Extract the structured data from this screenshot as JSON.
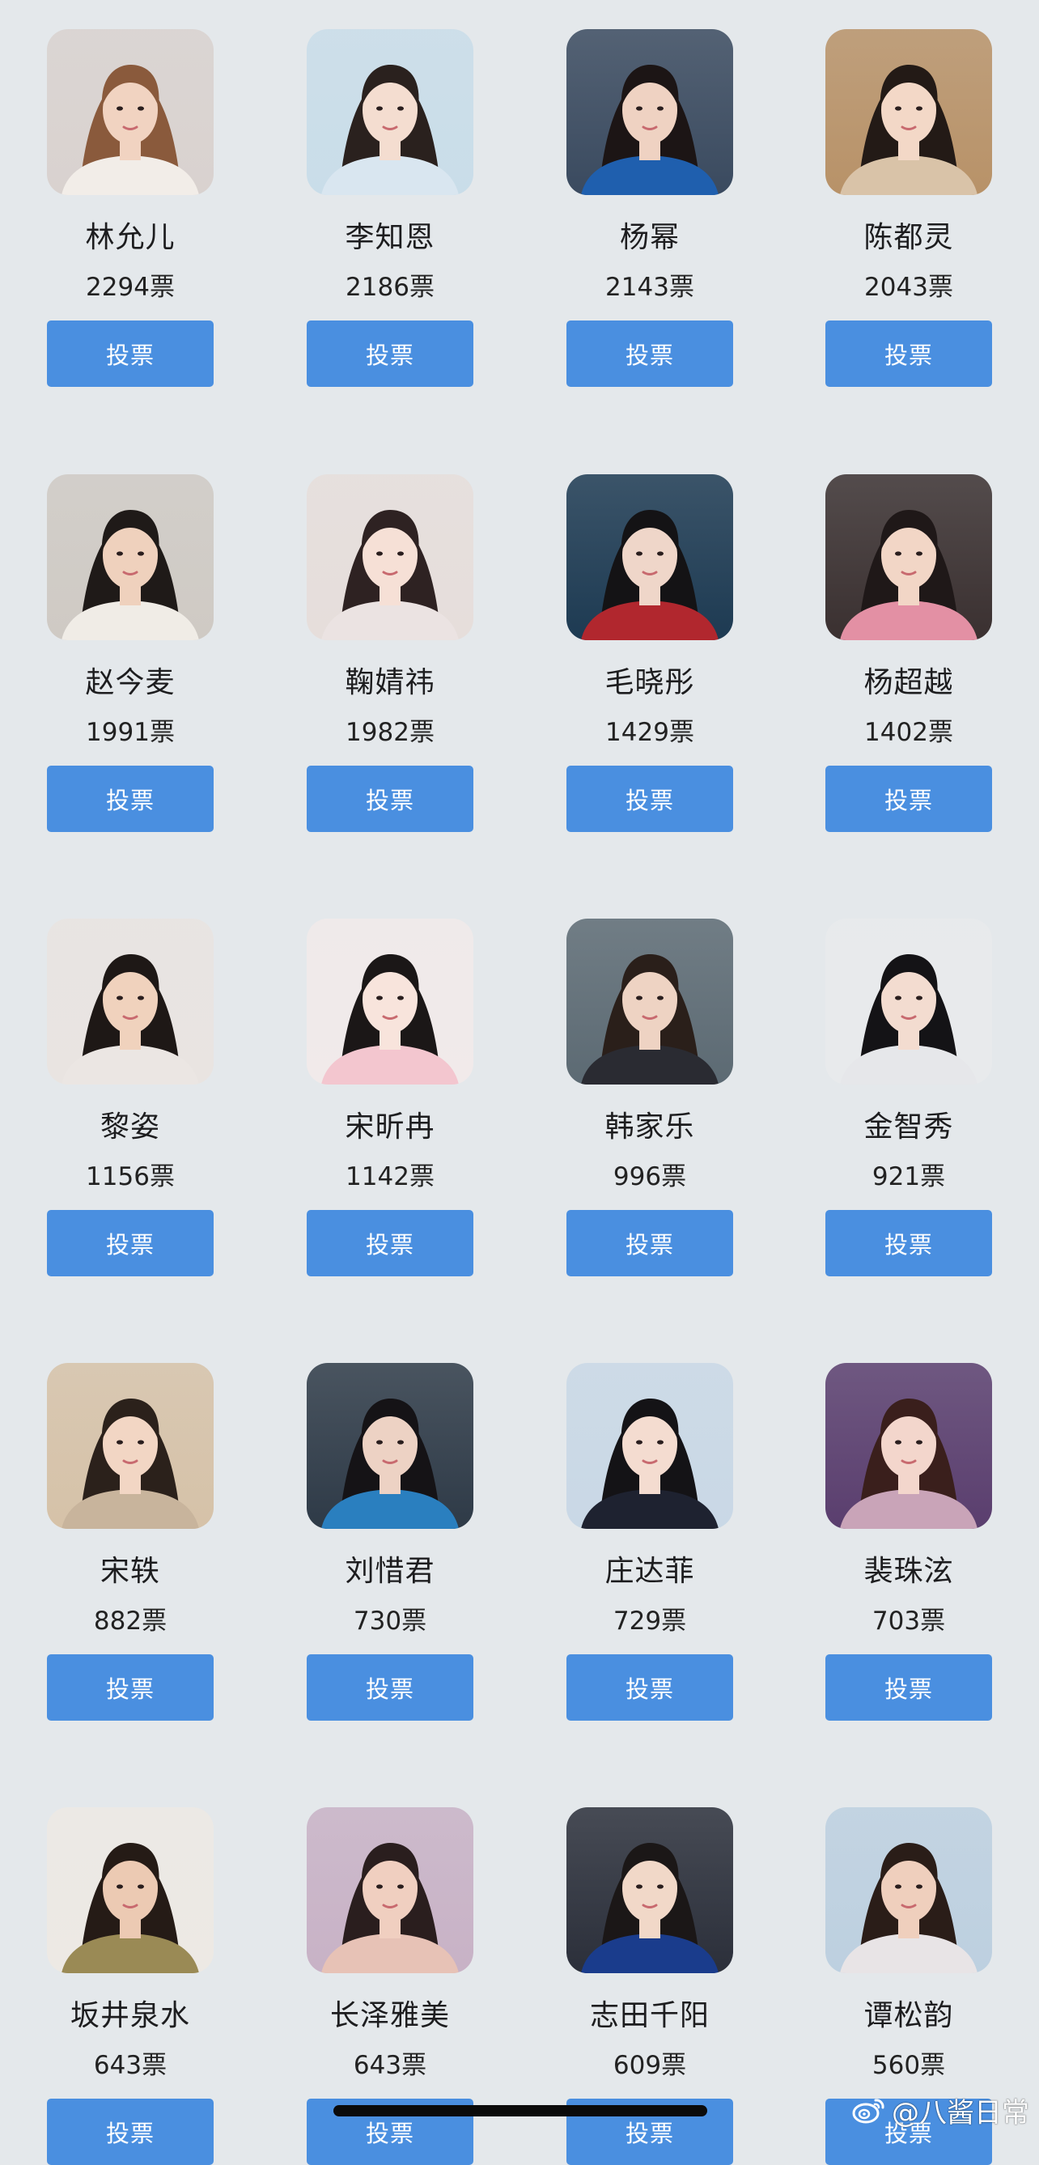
{
  "candidates": [
    {
      "name": "林允儿",
      "votes": "2294票",
      "vote_label": "投票",
      "photo": {
        "bg": "#d9d2cf",
        "hair": "#8a5a3c",
        "skin": "#f1d3c1",
        "cloth": "#f2ede8"
      }
    },
    {
      "name": "李知恩",
      "votes": "2186票",
      "vote_label": "投票",
      "photo": {
        "bg": "#c9dde9",
        "hair": "#2a211e",
        "skin": "#f4ddd0",
        "cloth": "#d9e6f0"
      }
    },
    {
      "name": "杨幂",
      "votes": "2143票",
      "vote_label": "投票",
      "photo": {
        "bg": "#3a4a5f",
        "hair": "#1c1515",
        "skin": "#efd2c2",
        "cloth": "#1f5fae"
      }
    },
    {
      "name": "陈都灵",
      "votes": "2043票",
      "vote_label": "投票",
      "photo": {
        "bg": "#b89268",
        "hair": "#231a16",
        "skin": "#f3d8c7",
        "cloth": "#d9c3a8"
      }
    },
    {
      "name": "赵今麦",
      "votes": "1991票",
      "vote_label": "投票",
      "photo": {
        "bg": "#cfcac4",
        "hair": "#1f1a18",
        "skin": "#efd1bd",
        "cloth": "#f0ece6"
      }
    },
    {
      "name": "鞠婧祎",
      "votes": "1982票",
      "vote_label": "投票",
      "photo": {
        "bg": "#e6dedb",
        "hair": "#2e2222",
        "skin": "#f6e0d6",
        "cloth": "#ebe3e2"
      }
    },
    {
      "name": "毛晓彤",
      "votes": "1429票",
      "vote_label": "投票",
      "photo": {
        "bg": "#1d3a52",
        "hair": "#141315",
        "skin": "#efd6c9",
        "cloth": "#b1272e"
      }
    },
    {
      "name": "杨超越",
      "votes": "1402票",
      "vote_label": "投票",
      "photo": {
        "bg": "#3a3030",
        "hair": "#1f1818",
        "skin": "#f2d6c6",
        "cloth": "#e390a4"
      }
    },
    {
      "name": "黎姿",
      "votes": "1156票",
      "vote_label": "投票",
      "photo": {
        "bg": "#e9e4e1",
        "hair": "#1e1816",
        "skin": "#f0d2bd",
        "cloth": "#ebe6e3"
      }
    },
    {
      "name": "宋昕冉",
      "votes": "1142票",
      "vote_label": "投票",
      "photo": {
        "bg": "#f1eaea",
        "hair": "#1b1717",
        "skin": "#f8e4dc",
        "cloth": "#f3c6cf"
      }
    },
    {
      "name": "韩家乐",
      "votes": "996票",
      "vote_label": "投票",
      "photo": {
        "bg": "#5c6a73",
        "hair": "#2a1f1a",
        "skin": "#eed3c3",
        "cloth": "#2a2b32"
      }
    },
    {
      "name": "金智秀",
      "votes": "921票",
      "vote_label": "投票",
      "photo": {
        "bg": "#e8eaec",
        "hair": "#141316",
        "skin": "#f3dcd0",
        "cloth": "#e6e7ea"
      }
    },
    {
      "name": "宋轶",
      "votes": "882票",
      "vote_label": "投票",
      "photo": {
        "bg": "#d6c2a8",
        "hair": "#2b211b",
        "skin": "#f2d6c4",
        "cloth": "#c8b49c"
      }
    },
    {
      "name": "刘惜君",
      "votes": "730票",
      "vote_label": "投票",
      "photo": {
        "bg": "#2e3a47",
        "hair": "#151316",
        "skin": "#edd2c4",
        "cloth": "#2a7fbf"
      }
    },
    {
      "name": "庄达菲",
      "votes": "729票",
      "vote_label": "投票",
      "photo": {
        "bg": "#c9d8e6",
        "hair": "#141316",
        "skin": "#f4dcd0",
        "cloth": "#1e2230"
      }
    },
    {
      "name": "裴珠泫",
      "votes": "703票",
      "vote_label": "投票",
      "photo": {
        "bg": "#5a3e6e",
        "hair": "#3a1f1c",
        "skin": "#f3d6cc",
        "cloth": "#c9a4b8"
      }
    },
    {
      "name": "坂井泉水",
      "votes": "643票",
      "vote_label": "投票",
      "photo": {
        "bg": "#ede9e4",
        "hair": "#251b16",
        "skin": "#eccab3",
        "cloth": "#9a8a55"
      }
    },
    {
      "name": "长泽雅美",
      "votes": "643票",
      "vote_label": "投票",
      "photo": {
        "bg": "#c8b2c6",
        "hair": "#2a1e1e",
        "skin": "#f0cfc0",
        "cloth": "#e7c2b6"
      }
    },
    {
      "name": "志田千阳",
      "votes": "609票",
      "vote_label": "投票",
      "photo": {
        "bg": "#2b2f3a",
        "hair": "#1b1717",
        "skin": "#f1d8c8",
        "cloth": "#1a3c8c"
      }
    },
    {
      "name": "谭松韵",
      "votes": "560票",
      "vote_label": "投票",
      "photo": {
        "bg": "#bdd0e0",
        "hair": "#2a1d18",
        "skin": "#efcfbd",
        "cloth": "#e8e4e6"
      }
    }
  ],
  "watermark": {
    "text": "@八酱日常",
    "icon": "weibo-icon"
  }
}
